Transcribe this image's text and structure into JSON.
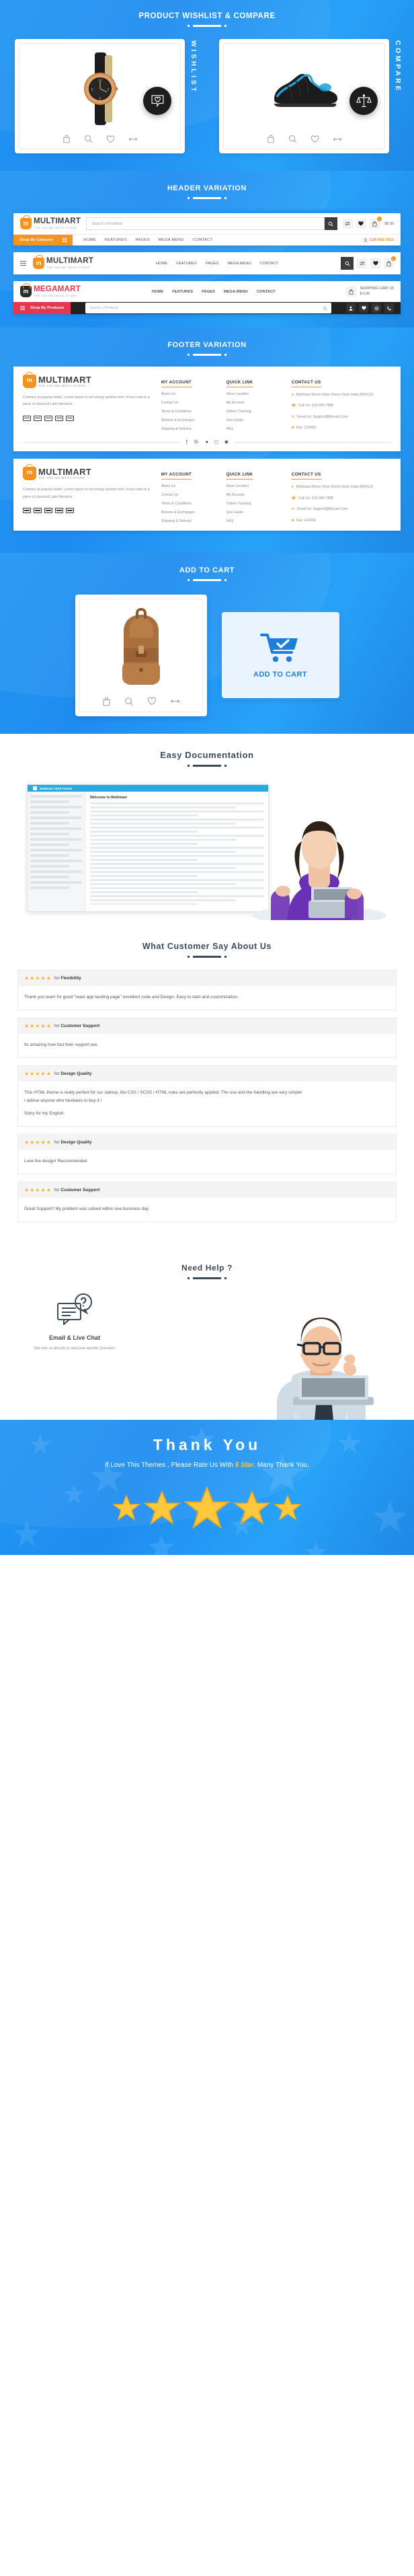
{
  "sections": {
    "wishlist": {
      "title": "PRODUCT WISHLIST & COMPARE",
      "vertical_labels": [
        "WISHLIST",
        "COMPARE"
      ],
      "cards": [
        {
          "product": "wrist-watch",
          "icons": [
            "bag-icon",
            "search-icon",
            "heart-icon",
            "compare-icon"
          ]
        },
        {
          "product": "sport-shoe",
          "icons": [
            "bag-icon",
            "search-icon",
            "heart-icon",
            "compare-icon"
          ]
        }
      ],
      "badges": [
        "wishlist-heart-badge",
        "compare-scale-badge"
      ]
    },
    "header": {
      "title": "HEADER VARIATION",
      "brand": {
        "name": "MULTIMART",
        "tagline": "THE ONLINE MEGA STORE"
      },
      "brand_alt": {
        "name": "MEGAMART",
        "tagline": "THE ONLINE MEGA STORE"
      },
      "search_placeholder": "Search a Products",
      "category_button": "Shop By Category",
      "category_button_alt": "Shop By Products",
      "nav": [
        "HOME",
        "FEATURES",
        "PAGES",
        "MEGA MENU",
        "CONTACT"
      ],
      "phone": "124-456-7813",
      "cart_total": "$0.00",
      "cart_count": "0",
      "cart_label_line1": "SHOPPING CART (3)",
      "cart_label_line2": "$ 0.00"
    },
    "footer": {
      "title": "FOOTER VARIATION",
      "description": "Contrary to popular belief, Lorem Ipsum is not simply random text. It has roots in a piece of classical Latin literature.",
      "columns": [
        {
          "heading": "MY ACCOUNT",
          "items": [
            "About Us",
            "Contact Us",
            "Terms & Conditions",
            "Returns & Exchanges",
            "Shipping & Delivery"
          ]
        },
        {
          "heading": "QUICK LINK",
          "items": [
            "Store Location",
            "My Account",
            "Orders Tracking",
            "Size Guide",
            "FAQ"
          ]
        }
      ],
      "contact_heading": "CONTACT US",
      "contact": [
        {
          "icon": "location-pin-icon",
          "text": "Multimart Demo Store Demo Store India-3654123"
        },
        {
          "icon": "phone-icon",
          "text": "Call Us: 123-456-7898"
        },
        {
          "icon": "envelope-icon",
          "text": "Email Us: Support@Mycart.Com"
        },
        {
          "icon": "fax-icon",
          "text": "Fax: 123456"
        }
      ],
      "social": [
        "facebook-icon",
        "google-plus-icon",
        "twitter-icon",
        "instagram-icon",
        "rss-icon"
      ],
      "payments": [
        "visa-card",
        "mastercard",
        "amex-card",
        "discover-card",
        "paypal-card"
      ]
    },
    "add_to_cart": {
      "title": "ADD TO CART",
      "product": "leather-backpack",
      "button_label": "ADD TO CART",
      "icons": [
        "bag-icon",
        "search-icon",
        "heart-icon",
        "compare-icon"
      ]
    },
    "documentation": {
      "title": "Easy Documentation",
      "browser_title": "Multimart Html Theme",
      "doc_heading": "Welcome to Multimart"
    },
    "testimonials": {
      "title": "What Customer Say About Us",
      "items": [
        {
          "stars": "★★★★★",
          "for_label": "for",
          "topic": "Flexibility",
          "paragraphs": [
            "Thank you team for good \"react app landing page\" excellent code and Design. Easy to start and customization."
          ]
        },
        {
          "stars": "★★★★★",
          "for_label": "for",
          "topic": "Customer Support",
          "paragraphs": [
            "Its amazing how fast their support are."
          ]
        },
        {
          "stars": "★★★★★",
          "for_label": "for",
          "topic": "Design Quality",
          "paragraphs": [
            "This HTML theme is really perfect for our startup, the CSS / SCSS / HTML rules are perfectly applied. The use and the handling are very simple!",
            "I advise anyone who hesitates to buy it !",
            "Sorry for my English."
          ]
        },
        {
          "stars": "★★★★★",
          "for_label": "for",
          "topic": "Design Quality",
          "paragraphs": [
            "Love the design! Recommended"
          ]
        },
        {
          "stars": "★★★★★",
          "for_label": "for",
          "topic": "Customer Support",
          "paragraphs": [
            "Great Support!! My problem was solved within one business day"
          ]
        }
      ]
    },
    "help": {
      "title": "Need Help ?",
      "icon": "chat-question-icon",
      "heading": "Email & Live Chat",
      "description": "Talk with us directly to ask your specific Question."
    },
    "thanks": {
      "title": "Thank You",
      "subtitle_pre": "If Love This Themes , Please Rate Us With ",
      "subtitle_highlight": "5 Star",
      "subtitle_post": ". Many Thank You.",
      "star_count": 5
    }
  },
  "colors": {
    "blue": "#2196f3",
    "orange": "#f6921e",
    "red": "#e8364f",
    "dark": "#212121",
    "star_gold": "#f5b423",
    "heading_dark": "#3b4a5a"
  }
}
